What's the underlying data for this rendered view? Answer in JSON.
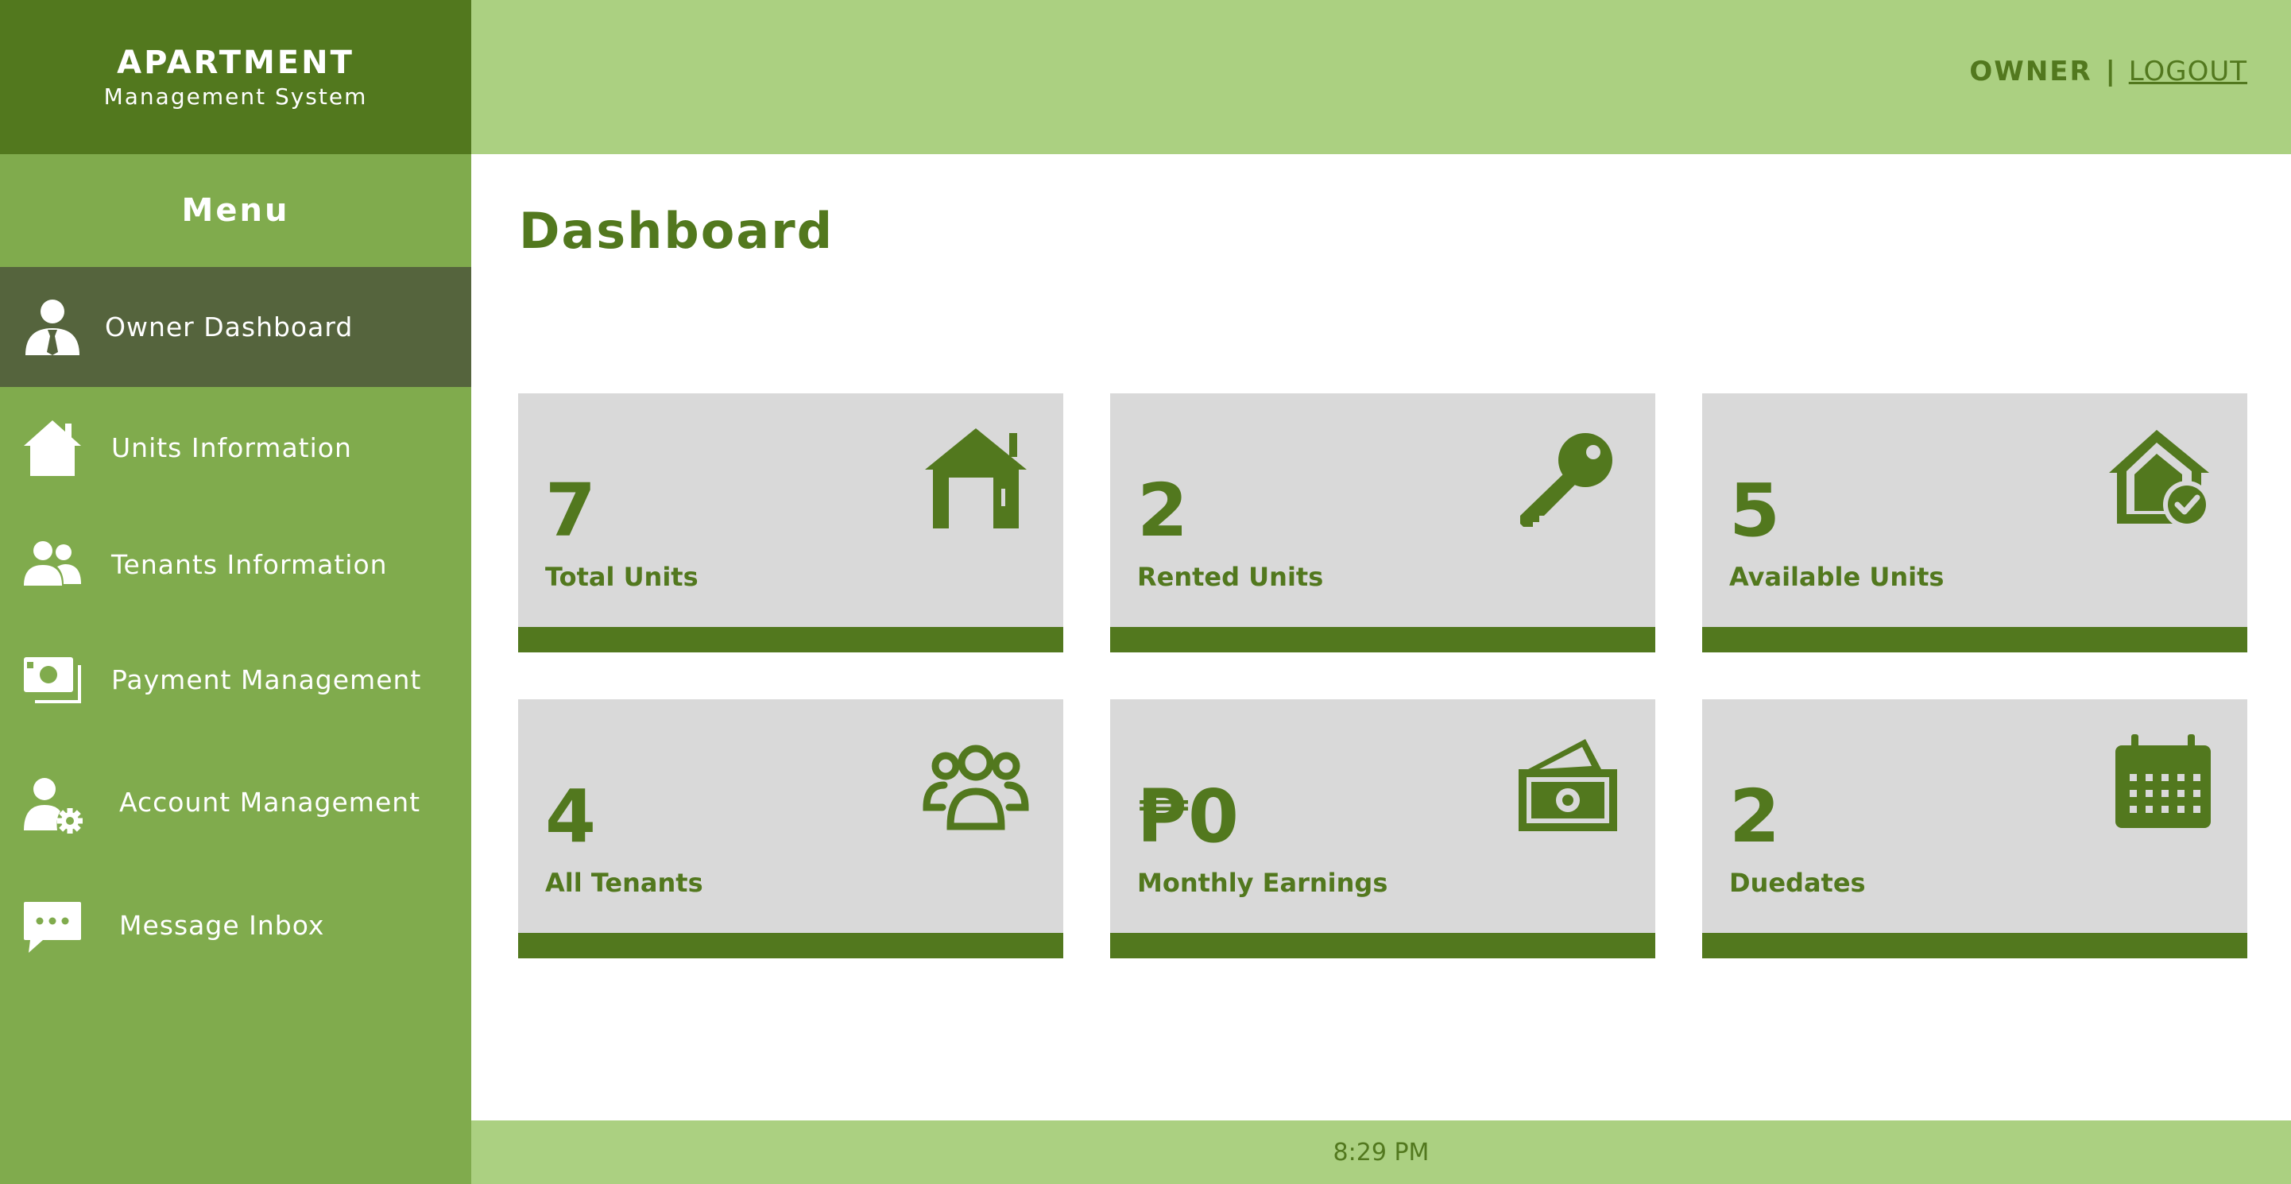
{
  "brand": {
    "title": "APARTMENT",
    "subtitle": "Management System"
  },
  "sidebar": {
    "heading": "Menu",
    "items": [
      {
        "label": "Owner Dashboard",
        "icon": "user-tie-icon",
        "active": true
      },
      {
        "label": "Units Information",
        "icon": "home-icon"
      },
      {
        "label": "Tenants Information",
        "icon": "users-icon"
      },
      {
        "label": "Payment Management",
        "icon": "money-icon"
      },
      {
        "label": "Account Management",
        "icon": "user-gear-icon"
      },
      {
        "label": "Message Inbox",
        "icon": "message-icon"
      }
    ]
  },
  "header": {
    "role": "OWNER",
    "separator": "|",
    "logout": "LOGOUT"
  },
  "main": {
    "title": "Dashboard",
    "cards": [
      {
        "value": "7",
        "label": "Total Units",
        "icon": "house-icon"
      },
      {
        "value": "2",
        "label": "Rented Units",
        "icon": "key-icon"
      },
      {
        "value": "5",
        "label": "Available Units",
        "icon": "house-check-icon"
      },
      {
        "value": "4",
        "label": "All Tenants",
        "icon": "users-outline-icon"
      },
      {
        "value": "₱0",
        "label": "Monthly Earnings",
        "icon": "money-bill-icon"
      },
      {
        "value": "2",
        "label": "Duedates",
        "icon": "calendar-icon"
      }
    ]
  },
  "footer": {
    "time": "8:29 PM"
  },
  "colors": {
    "dark_green": "#52781e",
    "sidebar_green": "#80ab4d",
    "light_green": "#abd081",
    "active_item": "#55643d",
    "card_bg": "#d9d9d9"
  }
}
